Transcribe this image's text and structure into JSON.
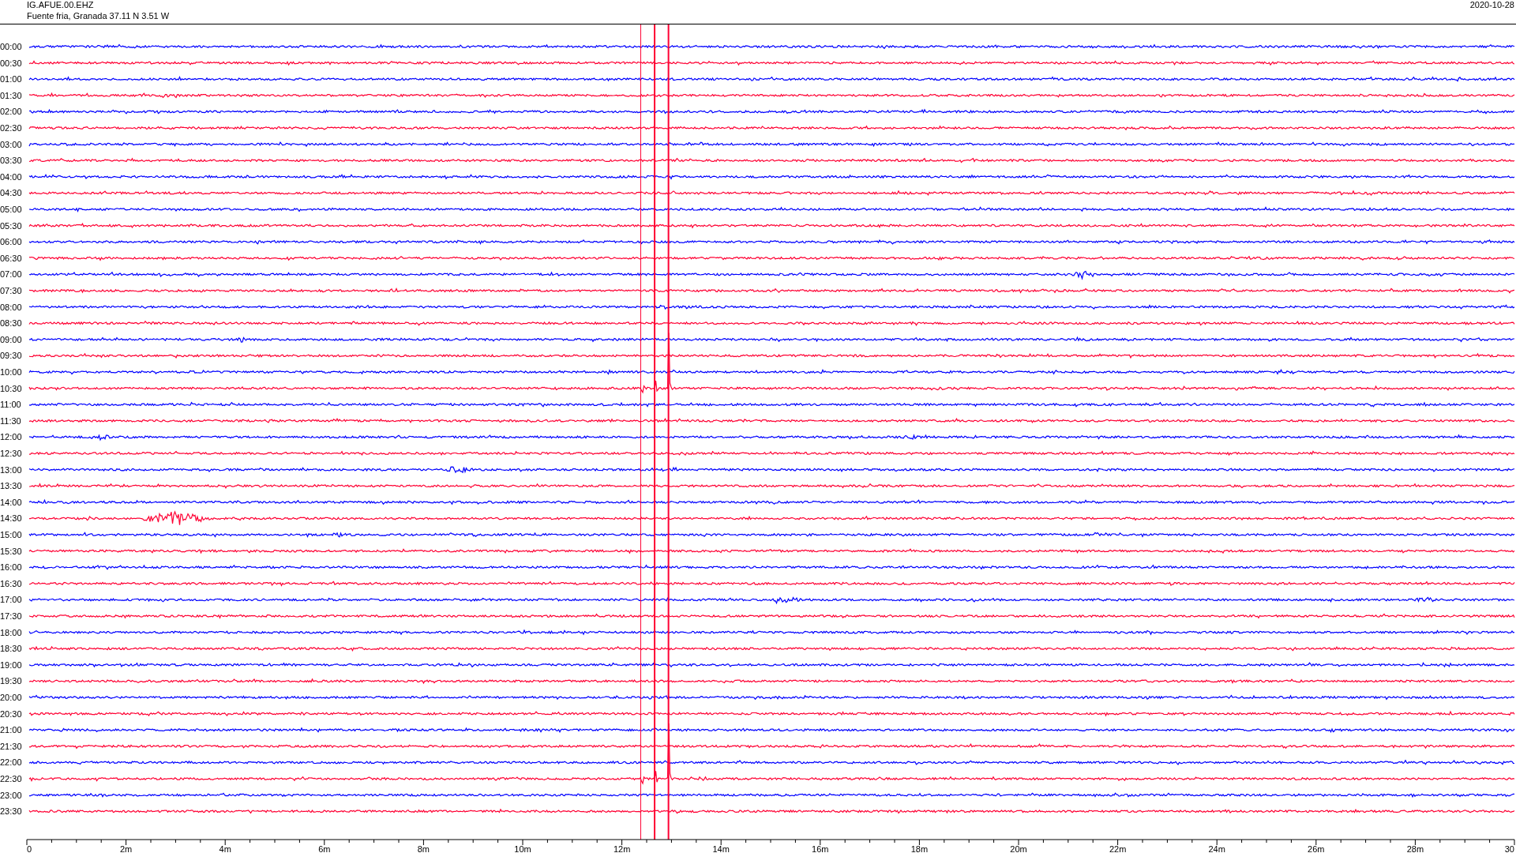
{
  "header": {
    "station": "IG.AFUE.00.EHZ",
    "location": "Fuente fria, Granada  37.11 N 3.51 W",
    "date": "2020-10-28"
  },
  "rows": [
    {
      "label": "00:00",
      "color": "#0000ff"
    },
    {
      "label": "00:30",
      "color": "#ff0033"
    },
    {
      "label": "01:00",
      "color": "#0000ff"
    },
    {
      "label": "01:30",
      "color": "#ff0033"
    },
    {
      "label": "02:00",
      "color": "#0000ff"
    },
    {
      "label": "02:30",
      "color": "#ff0033"
    },
    {
      "label": "03:00",
      "color": "#0000ff"
    },
    {
      "label": "03:30",
      "color": "#ff0033"
    },
    {
      "label": "04:00",
      "color": "#0000ff"
    },
    {
      "label": "04:30",
      "color": "#ff0033"
    },
    {
      "label": "05:00",
      "color": "#0000ff"
    },
    {
      "label": "05:30",
      "color": "#ff0033"
    },
    {
      "label": "06:00",
      "color": "#0000ff"
    },
    {
      "label": "06:30",
      "color": "#ff0033"
    },
    {
      "label": "07:00",
      "color": "#0000ff"
    },
    {
      "label": "07:30",
      "color": "#ff0033"
    },
    {
      "label": "08:00",
      "color": "#0000ff"
    },
    {
      "label": "08:30",
      "color": "#ff0033"
    },
    {
      "label": "09:00",
      "color": "#0000ff"
    },
    {
      "label": "09:30",
      "color": "#ff0033"
    },
    {
      "label": "10:00",
      "color": "#0000ff"
    },
    {
      "label": "10:30",
      "color": "#ff0033"
    },
    {
      "label": "11:00",
      "color": "#0000ff"
    },
    {
      "label": "11:30",
      "color": "#ff0033"
    },
    {
      "label": "12:00",
      "color": "#0000ff"
    },
    {
      "label": "12:30",
      "color": "#ff0033"
    },
    {
      "label": "13:00",
      "color": "#0000ff"
    },
    {
      "label": "13:30",
      "color": "#ff0033"
    },
    {
      "label": "14:00",
      "color": "#0000ff"
    },
    {
      "label": "14:30",
      "color": "#ff0033"
    },
    {
      "label": "15:00",
      "color": "#0000ff"
    },
    {
      "label": "15:30",
      "color": "#ff0033"
    },
    {
      "label": "16:00",
      "color": "#0000ff"
    },
    {
      "label": "16:30",
      "color": "#ff0033"
    },
    {
      "label": "17:00",
      "color": "#0000ff"
    },
    {
      "label": "17:30",
      "color": "#ff0033"
    },
    {
      "label": "18:00",
      "color": "#0000ff"
    },
    {
      "label": "18:30",
      "color": "#ff0033"
    },
    {
      "label": "19:00",
      "color": "#0000ff"
    },
    {
      "label": "19:30",
      "color": "#ff0033"
    },
    {
      "label": "20:00",
      "color": "#0000ff"
    },
    {
      "label": "20:30",
      "color": "#ff0033"
    },
    {
      "label": "21:00",
      "color": "#0000ff"
    },
    {
      "label": "21:30",
      "color": "#ff0033"
    },
    {
      "label": "22:00",
      "color": "#0000ff"
    },
    {
      "label": "22:30",
      "color": "#ff0033"
    },
    {
      "label": "23:00",
      "color": "#0000ff"
    },
    {
      "label": "23:30",
      "color": "#ff0033"
    }
  ],
  "x_axis": {
    "ticks": [
      "0",
      "2m",
      "4m",
      "6m",
      "8m",
      "10m",
      "12m",
      "14m",
      "16m",
      "18m",
      "20m",
      "22m",
      "24m",
      "26m",
      "28m",
      "30"
    ]
  }
}
